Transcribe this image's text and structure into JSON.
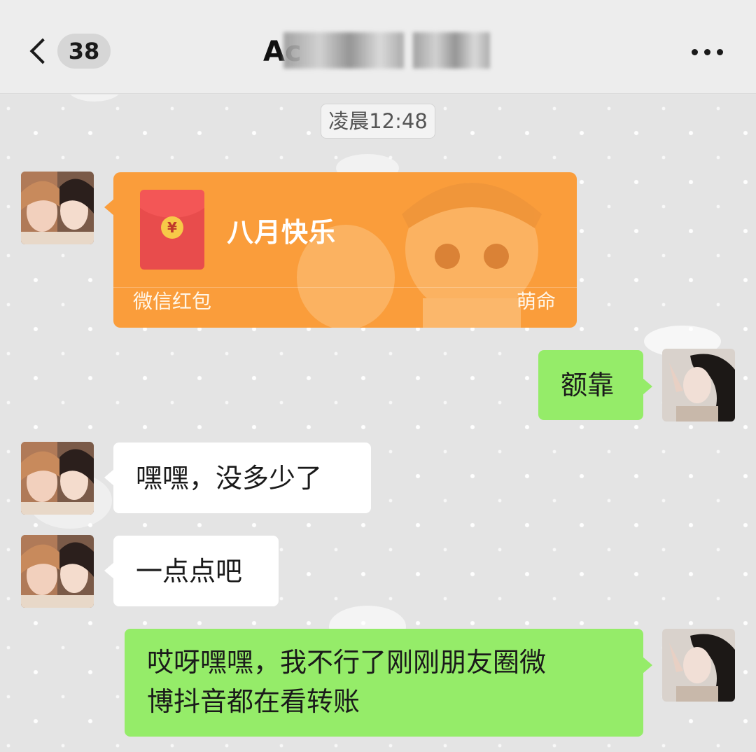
{
  "header": {
    "unread_count": "38",
    "title": "Ac"
  },
  "chat": {
    "timestamp": "凌晨12:48",
    "red_packet": {
      "title": "八月快乐",
      "label": "微信红包",
      "skin_name": "萌命",
      "coin_symbol": "¥"
    },
    "messages": [
      {
        "side": "right",
        "text": "额靠"
      },
      {
        "side": "left",
        "text": "嘿嘿，没多少了"
      },
      {
        "side": "left",
        "text": "一点点吧"
      },
      {
        "side": "right",
        "text_line1": "哎呀嘿嘿，我不行了刚刚朋友圈微",
        "text_line2": "博抖音都在看转账"
      }
    ]
  },
  "colors": {
    "header_bg": "#ededed",
    "chat_bg": "#e4e4e4",
    "bubble_left": "#ffffff",
    "bubble_right": "#95ec69",
    "red_packet": "#fa9d3b",
    "envelope": "#e84c4c"
  }
}
